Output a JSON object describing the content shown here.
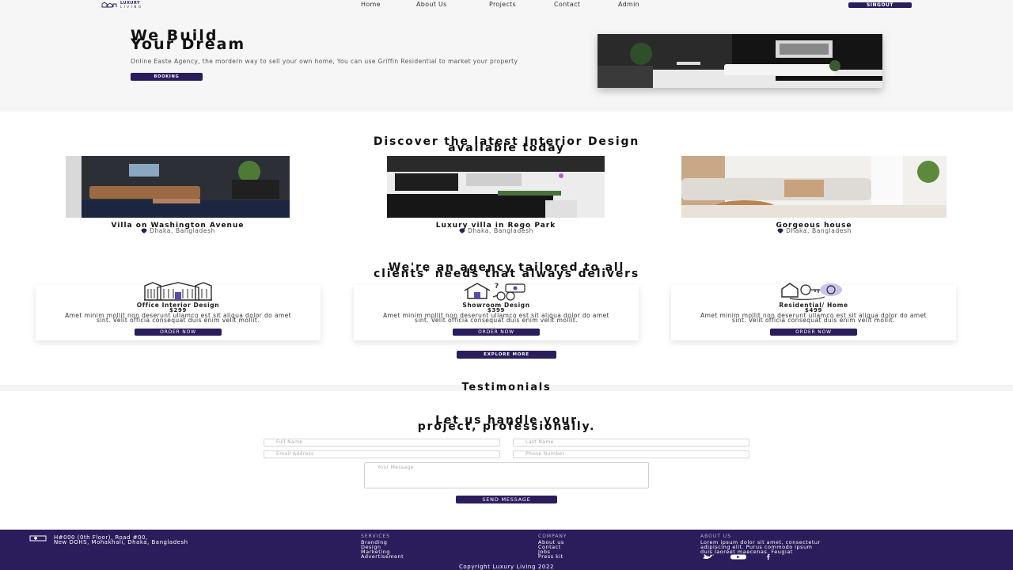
{
  "nav": {
    "logo_line1": "LUXURY",
    "logo_line2": "LIVING",
    "links": [
      "Home",
      "About Us",
      "Projects",
      "Contact",
      "Admin"
    ],
    "signout_label": "SINGOUT"
  },
  "hero": {
    "title_line1": "We Build",
    "title_line2": "Your Dream",
    "text": "Online Easte Agency, the mordern way to sell your own home, You can use Griffin Residential to market your property",
    "button_label": "BOOKING"
  },
  "discover": {
    "title_line1": "Discover the latest Interior Design",
    "title_line2": "available today",
    "cards": [
      {
        "name": "Villa on Washington Avenue",
        "location": "Dhaka, Bangladesh"
      },
      {
        "name": "Luxury villa in Rego Park",
        "location": "Dhaka, Bangladesh"
      },
      {
        "name": "Gorgeous house",
        "location": "Dhaka, Bangladesh"
      }
    ]
  },
  "agency": {
    "title_line1": "We're an agency tailored to all",
    "title_line2": "clients' needs that always delivers",
    "services": [
      {
        "name": "Office Interior Design",
        "price": "$299",
        "desc": "Amet minim mollit non deserunt ullamco est sit aliqua dolor do amet sint. Velit officia consequat duis enim velit mollit.",
        "button": "ORDER NOW",
        "icon": "office-building-icon"
      },
      {
        "name": "Showroom Design",
        "price": "$399",
        "desc": "Amet minim mollit non deserunt ullamco est sit aliqua dolor do amet sint. Velit officia consequat duis enim velit mollit.",
        "button": "ORDER NOW",
        "icon": "house-money-icon"
      },
      {
        "name": "Residential/ Home",
        "price": "$499",
        "desc": "Amet minim mollit non deserunt ullamco est sit aliqua dolor do amet sint. Velit officia consequat duis enim velit mollit.",
        "button": "ORDER NOW",
        "icon": "residential-key-icon"
      }
    ],
    "explore_label": "EXPLORE MORE"
  },
  "testimonials": {
    "title": "Testimonials"
  },
  "contact": {
    "title_line1": "Let us handle your",
    "title_line2": "project, professionally.",
    "placeholders": {
      "full_name": "Full Name",
      "last_name": "Last Name",
      "email": "Email Address",
      "phone": "Phone Number",
      "message": "Your Message"
    },
    "send_label": "SEND MESSAGE"
  },
  "footer": {
    "address_line1": "H#000 (0th Floor), Road #00,",
    "address_line2": "New DOHS, Mohakhali, Dhaka, Bangladesh",
    "services_heading": "SERVICES",
    "services": [
      "Branding",
      "Design",
      "Marketing",
      "Advertisement"
    ],
    "company_heading": "COMPANY",
    "company": [
      "About us",
      "Contact",
      "Jobs",
      "Press kit"
    ],
    "about_heading": "ABOUT US",
    "about_text_line1": "Lorem ipsum dolor sit amet, consectetur",
    "about_text_line2": "adipiscing elit. Purus commodo ipsum",
    "about_text_line3": "duis laoreet maecenas. Feugiat",
    "copyright": "Copyright Luxury Living 2022"
  },
  "colors": {
    "primary": "#2b1d5c",
    "hero_bg": "#f6f6f6"
  }
}
